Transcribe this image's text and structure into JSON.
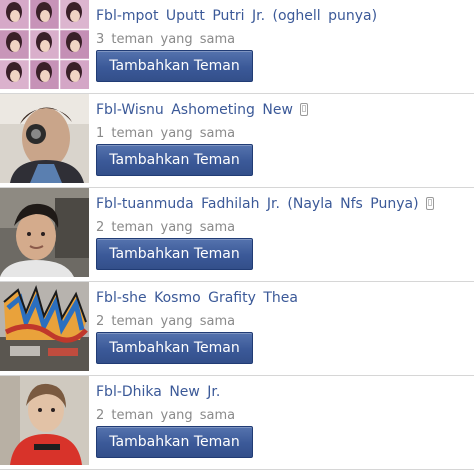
{
  "suggestions": [
    {
      "name": "Fbl-mpot Uputt Putri Jr. (oghell punya)",
      "mutual": "3 teman yang sama",
      "button_label": "Tambahkan Teman",
      "mobile_icon": null,
      "photo_icon": "grid-collage-photo"
    },
    {
      "name": "Fbl-Wisnu Ashometing New",
      "mutual": "1 teman yang sama",
      "button_label": "Tambahkan Teman",
      "mobile_icon": "mobile-phone-icon",
      "photo_icon": "boy-with-camera-photo"
    },
    {
      "name": "Fbl-tuanmuda Fadhilah Jr. (Nayla Nfs Punya)",
      "mutual": "2 teman yang sama",
      "button_label": "Tambahkan Teman",
      "mobile_icon": "mobile-phone-icon",
      "photo_icon": "boy-selfie-photo"
    },
    {
      "name": "Fbl-she Kosmo Grafity Thea",
      "mutual": "2 teman yang sama",
      "button_label": "Tambahkan Teman",
      "mobile_icon": null,
      "photo_icon": "graffiti-photo"
    },
    {
      "name": "Fbl-Dhika New Jr.",
      "mutual": "2 teman yang sama",
      "button_label": "Tambahkan Teman",
      "mobile_icon": null,
      "photo_icon": "boy-red-shirt-photo"
    }
  ],
  "colors": {
    "name_link": "#3b5998",
    "button_bg": "#3b5998",
    "mutual_text": "#8a8a8a",
    "divider": "#d6d6d6"
  }
}
